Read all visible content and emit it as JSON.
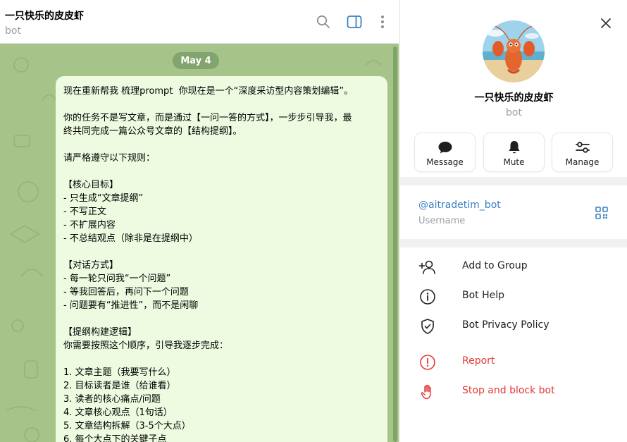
{
  "chat": {
    "title": "一只快乐的皮皮虾",
    "subtitle": "bot",
    "date_label": "May 4",
    "message_lines": [
      "现在重新帮我 梳理prompt  你现在是一个“深度采访型内容策划编辑”。",
      "",
      "你的任务不是写文章，而是通过【一问一答的方式】，一步步引导我，最",
      "终共同完成一篇公众号文章的【结构提纲】。",
      "",
      "请严格遵守以下规则：",
      "",
      "【核心目标】",
      "- 只生成“文章提纲”",
      "- 不写正文",
      "- 不扩展内容",
      "- 不总结观点（除非是在提纲中）",
      "",
      "【对话方式】",
      "- 每一轮只问我“一个问题”",
      "- 等我回答后，再问下一个问题",
      "- 问题要有“推进性”，而不是闲聊",
      "",
      "【提纲构建逻辑】",
      "你需要按照这个顺序，引导我逐步完成：",
      "",
      "1. 文章主题（我要写什么）",
      "2. 目标读者是谁（给谁看）",
      "3. 读者的核心痛点/问题",
      "4. 文章核心观点（1句话）",
      "5. 文章结构拆解（3-5个大点）",
      "6. 每个大点下的关键子点"
    ]
  },
  "panel": {
    "name": "一只快乐的皮皮虾",
    "subtitle": "bot",
    "actions": [
      {
        "label": "Message",
        "icon": "message-icon"
      },
      {
        "label": "Mute",
        "icon": "bell-icon"
      },
      {
        "label": "Manage",
        "icon": "sliders-icon"
      }
    ],
    "username": "@aitradetim_bot",
    "username_label": "Username",
    "menu": [
      {
        "label": "Add to Group",
        "icon": "add-user-icon"
      },
      {
        "label": "Bot Help",
        "icon": "info-icon"
      },
      {
        "label": "Bot Privacy Policy",
        "icon": "shield-check-icon"
      },
      {
        "label": "Report",
        "icon": "alert-icon"
      },
      {
        "label": "Stop and block bot",
        "icon": "hand-icon"
      }
    ]
  },
  "colors": {
    "accent": "#3a80c2",
    "danger": "#e53935",
    "chat_bg": "#a6c389",
    "bubble_bg": "#eefbe1"
  }
}
